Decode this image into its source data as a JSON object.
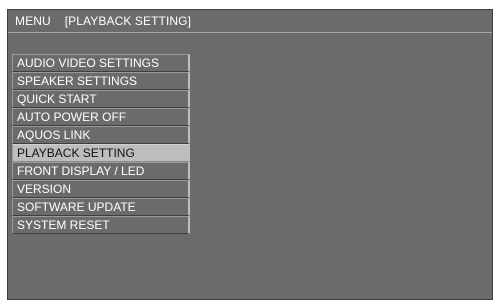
{
  "header": {
    "menu_label": "MENU",
    "current_section": "[PLAYBACK SETTING]"
  },
  "menu": {
    "items": [
      {
        "label": "AUDIO VIDEO SETTINGS"
      },
      {
        "label": "SPEAKER SETTINGS"
      },
      {
        "label": "QUICK START"
      },
      {
        "label": "AUTO POWER OFF"
      },
      {
        "label": "AQUOS LINK"
      },
      {
        "label": "PLAYBACK SETTING"
      },
      {
        "label": "FRONT DISPLAY / LED"
      },
      {
        "label": "VERSION"
      },
      {
        "label": "SOFTWARE UPDATE"
      },
      {
        "label": "SYSTEM RESET"
      }
    ],
    "selected": "PLAYBACK SETTING"
  },
  "colors": {
    "screen_background": "#6b6b6b",
    "highlight": "#bdbdbd",
    "text": "#ffffff"
  }
}
